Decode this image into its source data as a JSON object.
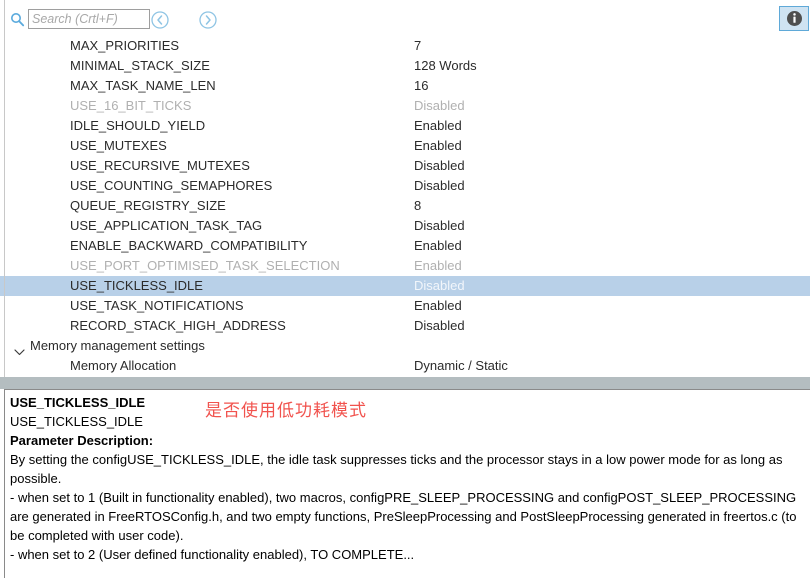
{
  "toolbar": {
    "search": {
      "placeholder": "Search (Crtl+F)",
      "value": "",
      "icon": "search-icon"
    },
    "prev_label": "‹",
    "next_label": "›",
    "info_label": "i"
  },
  "tree": {
    "rows": [
      {
        "name": "MAX_PRIORITIES",
        "value": "7",
        "state": "normal"
      },
      {
        "name": "MINIMAL_STACK_SIZE",
        "value": "128 Words",
        "state": "normal"
      },
      {
        "name": "MAX_TASK_NAME_LEN",
        "value": "16",
        "state": "normal"
      },
      {
        "name": "USE_16_BIT_TICKS",
        "value": "Disabled",
        "state": "dim"
      },
      {
        "name": "IDLE_SHOULD_YIELD",
        "value": "Enabled",
        "state": "normal"
      },
      {
        "name": "USE_MUTEXES",
        "value": "Enabled",
        "state": "normal"
      },
      {
        "name": "USE_RECURSIVE_MUTEXES",
        "value": "Disabled",
        "state": "normal"
      },
      {
        "name": "USE_COUNTING_SEMAPHORES",
        "value": "Disabled",
        "state": "normal"
      },
      {
        "name": "QUEUE_REGISTRY_SIZE",
        "value": "8",
        "state": "normal"
      },
      {
        "name": "USE_APPLICATION_TASK_TAG",
        "value": "Disabled",
        "state": "normal"
      },
      {
        "name": "ENABLE_BACKWARD_COMPATIBILITY",
        "value": "Enabled",
        "state": "normal"
      },
      {
        "name": "USE_PORT_OPTIMISED_TASK_SELECTION",
        "value": "Enabled",
        "state": "dim"
      },
      {
        "name": "USE_TICKLESS_IDLE",
        "value": "Disabled",
        "state": "selected"
      },
      {
        "name": "USE_TASK_NOTIFICATIONS",
        "value": "Enabled",
        "state": "normal"
      },
      {
        "name": "RECORD_STACK_HIGH_ADDRESS",
        "value": "Disabled",
        "state": "normal"
      }
    ],
    "group": {
      "label": "Memory management settings",
      "expanded": true,
      "icon": "chevron-down-icon"
    },
    "group_rows": [
      {
        "name": "Memory Allocation",
        "value": "Dynamic / Static",
        "state": "normal"
      }
    ]
  },
  "description": {
    "title": "USE_TICKLESS_IDLE",
    "subtitle": "USE_TICKLESS_IDLE",
    "section_label": "Parameter Description:",
    "annotation": "是否使用低功耗模式",
    "annotation_color": "#f1534e",
    "body_1": "By setting the configUSE_TICKLESS_IDLE, the idle task suppresses ticks and the processor stays in a low power mode for as long as possible.",
    "body_2": "- when set to 1 (Built in functionality enabled), two macros, configPRE_SLEEP_PROCESSING and configPOST_SLEEP_PROCESSING are generated in FreeRTOSConfig.h, and two empty functions, PreSleepProcessing and PostSleepProcessing generated in freertos.c (to be completed with user code).",
    "body_3": "- when set to 2 (User defined functionality enabled), TO COMPLETE..."
  }
}
